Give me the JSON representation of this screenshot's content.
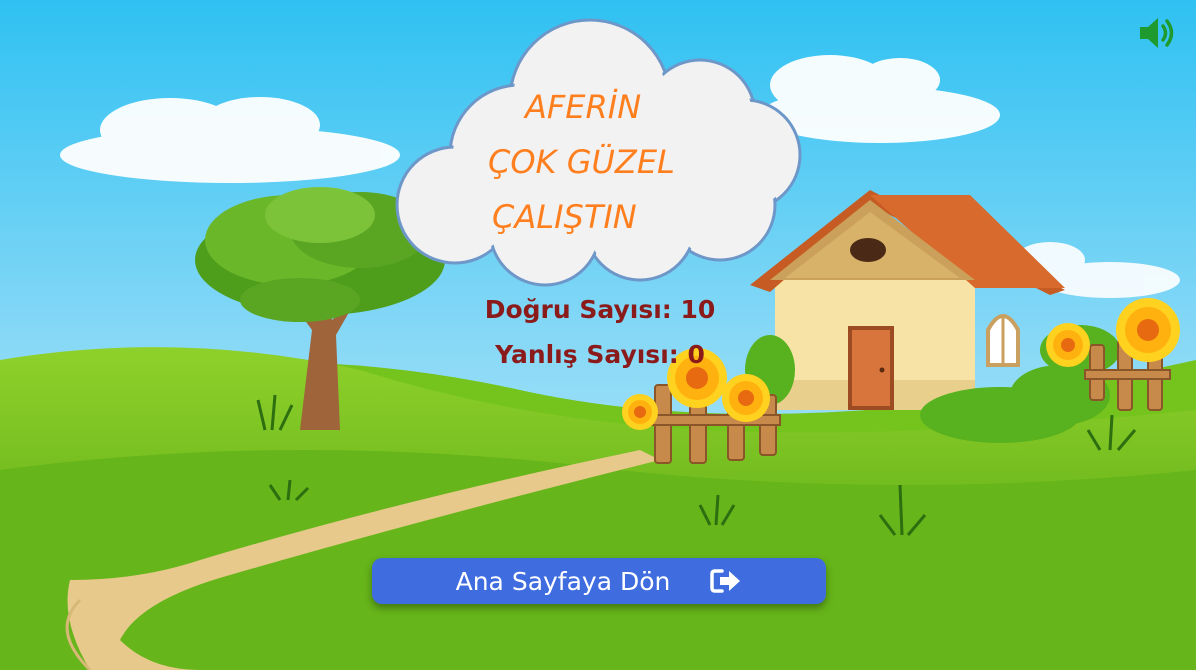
{
  "message": {
    "line1": "AFERİN",
    "line2": "ÇOK GÜZEL",
    "line3": "ÇALIŞTIN"
  },
  "score": {
    "correct": "Doğru Sayısı: 10",
    "wrong": "Yanlış Sayısı: 0"
  },
  "home_button": {
    "label": "Ana Sayfaya Dön",
    "icon": "sign-out-icon"
  },
  "sound_button": {
    "icon": "speaker-volume-icon"
  },
  "colors": {
    "sky_top": "#33c3f0",
    "grass": "#6ab718",
    "message_text": "#ff7f1e",
    "score_text": "#8b1a1a",
    "button": "#3f6de0",
    "sound_icon": "#1e9a2e"
  }
}
